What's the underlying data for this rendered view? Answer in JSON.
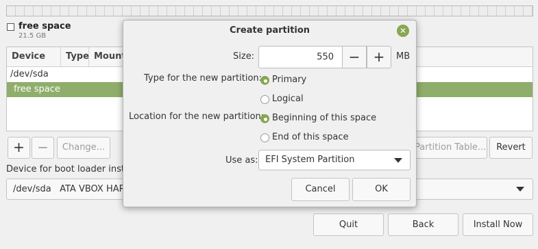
{
  "legend": {
    "name": "free space",
    "size": "21.5 GB"
  },
  "table": {
    "columns": [
      "Device",
      "Type",
      "Mount"
    ],
    "rows": [
      "/dev/sda",
      "free space"
    ]
  },
  "table_buttons": {
    "add": "+",
    "remove": "−",
    "change": "Change...",
    "new_partition_table": "Partition Table...",
    "revert": "Revert"
  },
  "boot_loader": {
    "label": "Device for boot loader instal",
    "device": "/dev/sda",
    "description": "ATA VBOX HARI"
  },
  "bottom_buttons": {
    "quit": "Quit",
    "back": "Back",
    "install_now": "Install Now"
  },
  "dialog": {
    "title": "Create partition",
    "close_glyph": "✕",
    "size_label": "Size:",
    "size_value": "550",
    "minus": "−",
    "plus": "+",
    "unit": "MB",
    "type_label": "Type for the new partition:",
    "type_options": [
      "Primary",
      "Logical"
    ],
    "type_selected": "Primary",
    "location_label": "Location for the new partition:",
    "location_options": [
      "Beginning of this space",
      "End of this space"
    ],
    "location_selected": "Beginning of this space",
    "use_as_label": "Use as:",
    "use_as_value": "EFI System Partition",
    "cancel": "Cancel",
    "ok": "OK"
  },
  "colors": {
    "accent": "#87a752",
    "selection": "#8fae6b"
  }
}
